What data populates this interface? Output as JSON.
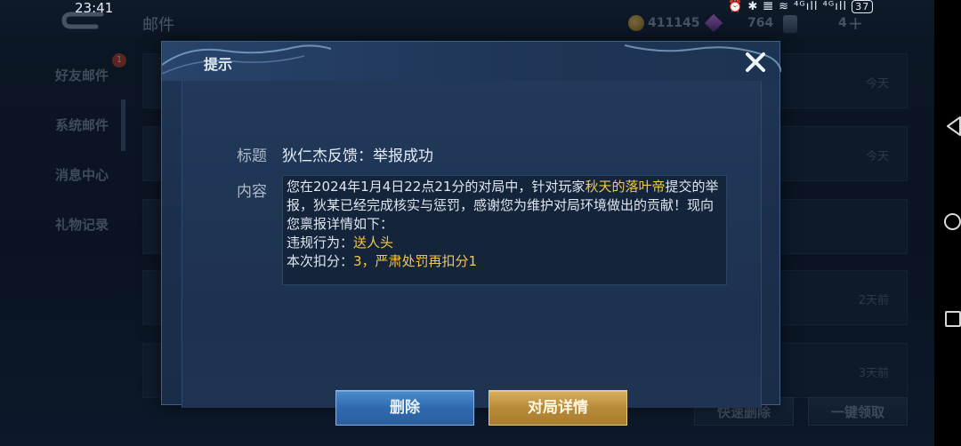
{
  "status_bar": {
    "time": "23:41",
    "icons_text": "⏰ ✱ 𝌆 ≋ ⁴ᴳıll ⁴ᴳıll",
    "battery": "37"
  },
  "background": {
    "page_title": "邮件",
    "gold": "411145",
    "gems": "764",
    "tickets": "4",
    "plus_symbol": "+",
    "sidebar": [
      {
        "label": "好友邮件",
        "badge": "1"
      },
      {
        "label": "系统邮件"
      },
      {
        "label": "消息中心"
      },
      {
        "label": "礼物记录"
      }
    ],
    "rows": [
      {
        "time": "今天"
      },
      {
        "time": "今天"
      },
      {
        "time": ""
      },
      {
        "time": "2天前"
      },
      {
        "time": "3天前"
      }
    ],
    "quick_delete_label": "快速删除",
    "claim_all_label": "一键领取"
  },
  "dialog": {
    "title": "提示",
    "subject_label": "标题",
    "subject": "狄仁杰反馈：举报成功",
    "content_label": "内容",
    "content": {
      "p1_a": "您在2024年1月4日22点21分的对局中，针对玩家",
      "player": "秋天的落叶帝",
      "p1_b": "提交的举报，狄某已经完成核实与惩罚，感谢您为维护对局环境做出的贡献！现向您禀报详情如下：",
      "violation_label": "违规行为：",
      "violation": "送人头",
      "deduction_label": "本次扣分：",
      "deduction": "3，严肃处罚再扣分1"
    },
    "delete_label": "删除",
    "detail_label": "对局详情"
  },
  "colors": {
    "highlight": "#f2c84b",
    "delete_button": "#3b78bd",
    "detail_button": "#c49a45"
  }
}
